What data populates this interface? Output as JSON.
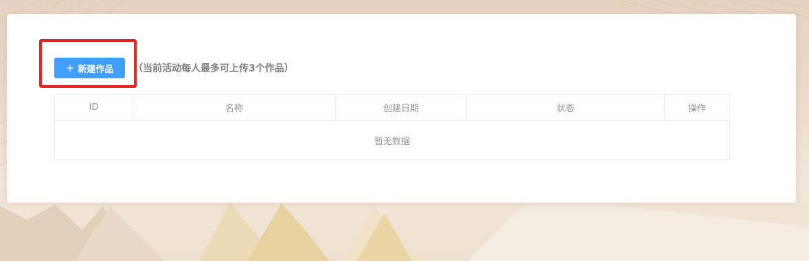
{
  "toolbar": {
    "create_icon": "plus-icon",
    "create_label": "新建作品",
    "hint": "（当前活动每人最多可上传3个作品）"
  },
  "table": {
    "columns": [
      "ID",
      "名称",
      "创建日期",
      "状态",
      "操作"
    ],
    "empty_text": "暂无数据"
  },
  "colors": {
    "primary": "#409eff",
    "highlight": "#e8251f",
    "muted_text": "#909399"
  }
}
